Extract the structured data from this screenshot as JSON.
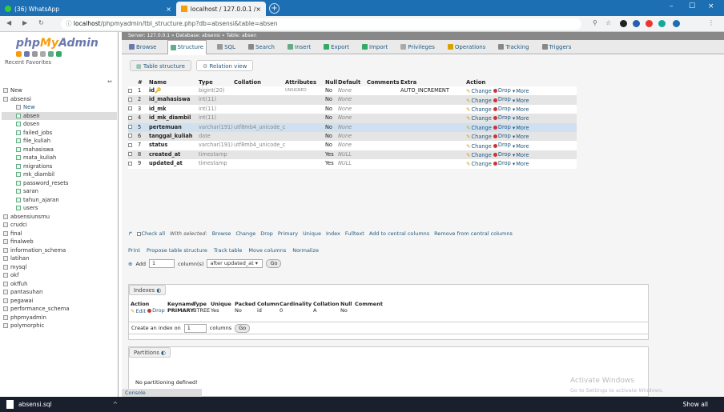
{
  "browser": {
    "tab1": {
      "title": "(36) WhatsApp",
      "close": "×"
    },
    "tab2": {
      "title": "localhost / 127.0.0.1 / absensi / ",
      "close": "×"
    },
    "newtab": "+",
    "url_host": "localhost",
    "url_path": "/phpmyadmin/tbl_structure.php?db=absensi&table=absen",
    "min": "–",
    "max": "☐",
    "close": "×"
  },
  "sidebar": {
    "logo_php": "php",
    "logo_my": "My",
    "logo_admin": "Admin",
    "recent": "Recent",
    "favorites": "Favorites",
    "tree": [
      {
        "label": "New",
        "type": "db"
      },
      {
        "label": "absensi",
        "type": "db"
      },
      {
        "label": "New",
        "type": "new"
      },
      {
        "label": "absen",
        "type": "child",
        "selected": true
      },
      {
        "label": "dosen",
        "type": "child"
      },
      {
        "label": "failed_jobs",
        "type": "child"
      },
      {
        "label": "file_kuliah",
        "type": "child"
      },
      {
        "label": "mahasiswa",
        "type": "child"
      },
      {
        "label": "mata_kuliah",
        "type": "child"
      },
      {
        "label": "migrations",
        "type": "child"
      },
      {
        "label": "mk_diambil",
        "type": "child"
      },
      {
        "label": "password_resets",
        "type": "child"
      },
      {
        "label": "saran",
        "type": "child"
      },
      {
        "label": "tahun_ajaran",
        "type": "child"
      },
      {
        "label": "users",
        "type": "child"
      },
      {
        "label": "absensiunsmu",
        "type": "db"
      },
      {
        "label": "crudci",
        "type": "db"
      },
      {
        "label": "final",
        "type": "db"
      },
      {
        "label": "finalweb",
        "type": "db"
      },
      {
        "label": "information_schema",
        "type": "db"
      },
      {
        "label": "latihan",
        "type": "db"
      },
      {
        "label": "mysql",
        "type": "db"
      },
      {
        "label": "okf",
        "type": "db"
      },
      {
        "label": "okffuh",
        "type": "db"
      },
      {
        "label": "pantasuhan",
        "type": "db"
      },
      {
        "label": "pegawai",
        "type": "db"
      },
      {
        "label": "performance_schema",
        "type": "db"
      },
      {
        "label": "phpmyadmin",
        "type": "db"
      },
      {
        "label": "polymorphic",
        "type": "db"
      }
    ]
  },
  "breadcrumb": "Server: 127.0.0.1 » Database: absensi » Table: absen",
  "tabs": [
    {
      "label": "Browse",
      "active": false
    },
    {
      "label": "Structure",
      "active": true
    },
    {
      "label": "SQL",
      "active": false
    },
    {
      "label": "Search",
      "active": false
    },
    {
      "label": "Insert",
      "active": false
    },
    {
      "label": "Export",
      "active": false
    },
    {
      "label": "Import",
      "active": false
    },
    {
      "label": "Privileges",
      "active": false
    },
    {
      "label": "Operations",
      "active": false
    },
    {
      "label": "Tracking",
      "active": false
    },
    {
      "label": "Triggers",
      "active": false
    }
  ],
  "subtabs": {
    "structure": "Table structure",
    "relation": "Relation view"
  },
  "columns_header": [
    "#",
    "Name",
    "Type",
    "Collation",
    "Attributes",
    "Null",
    "Default",
    "Comments",
    "Extra",
    "Action"
  ],
  "rows": [
    {
      "n": "1",
      "name": "id",
      "key": "🔑",
      "type": "bigint(20)",
      "collation": "",
      "attributes": "UNSIGNED",
      "null": "No",
      "default": "None",
      "extra": "AUTO_INCREMENT"
    },
    {
      "n": "2",
      "name": "id_mahasiswa",
      "type": "int(11)",
      "collation": "",
      "attributes": "",
      "null": "No",
      "default": "None",
      "extra": ""
    },
    {
      "n": "3",
      "name": "id_mk",
      "type": "int(11)",
      "collation": "",
      "attributes": "",
      "null": "No",
      "default": "None",
      "extra": ""
    },
    {
      "n": "4",
      "name": "id_mk_diambil",
      "type": "int(11)",
      "collation": "",
      "attributes": "",
      "null": "No",
      "default": "None",
      "extra": ""
    },
    {
      "n": "5",
      "name": "pertemuan",
      "type": "varchar(191)",
      "collation": "utf8mb4_unicode_ci",
      "attributes": "",
      "null": "No",
      "default": "None",
      "extra": ""
    },
    {
      "n": "6",
      "name": "tanggal_kuliah",
      "type": "date",
      "collation": "",
      "attributes": "",
      "null": "No",
      "default": "None",
      "extra": ""
    },
    {
      "n": "7",
      "name": "status",
      "type": "varchar(191)",
      "collation": "utf8mb4_unicode_ci",
      "attributes": "",
      "null": "No",
      "default": "None",
      "extra": ""
    },
    {
      "n": "8",
      "name": "created_at",
      "type": "timestamp",
      "collation": "",
      "attributes": "",
      "null": "Yes",
      "default": "NULL",
      "extra": ""
    },
    {
      "n": "9",
      "name": "updated_at",
      "type": "timestamp",
      "collation": "",
      "attributes": "",
      "null": "Yes",
      "default": "NULL",
      "extra": ""
    }
  ],
  "row_actions": {
    "change": "Change",
    "drop": "Drop",
    "more": "More"
  },
  "bulk": {
    "check_all": "Check all",
    "with_selected": "With selected:",
    "items": [
      "Browse",
      "Change",
      "Drop",
      "Primary",
      "Unique",
      "Index",
      "Fulltext",
      "Add to central columns",
      "Remove from central columns"
    ]
  },
  "tools": [
    "Print",
    "Propose table structure",
    "Track table",
    "Move columns",
    "Normalize"
  ],
  "add": {
    "label": "Add",
    "count": "1",
    "columns": "column(s)",
    "position": "after updated_at",
    "go": "Go"
  },
  "indexes": {
    "legend": "Indexes",
    "headers": [
      "Action",
      "Keyname",
      "Type",
      "Unique",
      "Packed",
      "Column",
      "Cardinality",
      "Collation",
      "Null",
      "Comment"
    ],
    "row": {
      "edit": "Edit",
      "drop": "Drop",
      "keyname": "PRIMARY",
      "type": "BTREE",
      "unique": "Yes",
      "packed": "No",
      "column": "id",
      "cardinality": "0",
      "collation": "A",
      "null": "No",
      "comment": ""
    }
  },
  "create_index": {
    "label": "Create an index on",
    "count": "1",
    "columns": "columns",
    "go": "Go"
  },
  "partitions": {
    "legend": "Partitions",
    "message": "No partitioning defined!"
  },
  "console": "Console",
  "watermark": {
    "title": "Activate Windows",
    "sub": "Go to Settings to activate Windows."
  },
  "taskbar": {
    "file": "absensi.sql",
    "chevron": "^",
    "showall": "Show all"
  },
  "colors": {
    "accent": "#235a81",
    "tabbar": "#1d6fb3"
  }
}
